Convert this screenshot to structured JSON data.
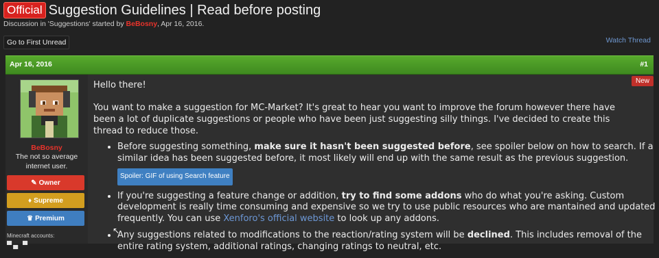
{
  "thread": {
    "prefix": "Official",
    "title": "Suggestion Guidelines | Read before posting",
    "meta_before": "Discussion in 'Suggestions' started by",
    "meta_user": "BeBosny",
    "meta_after": ", Apr 16, 2016.",
    "goto_first_unread": "Go to First Unread",
    "watch_thread": "Watch Thread"
  },
  "post": {
    "date": "Apr 16, 2016",
    "number": "#1",
    "new_label": "New",
    "author": {
      "name": "BeBosny",
      "user_title": "The not so average internet user.",
      "badges": [
        {
          "icon": "✎",
          "label": "Owner"
        },
        {
          "icon": "♦",
          "label": "Supreme"
        },
        {
          "icon": "♛",
          "label": "Premium"
        }
      ],
      "minecraft_label": "Minecraft accounts:",
      "minecraft_icons": "▀▄ ▀"
    },
    "greeting": "Hello there!",
    "intro": "You want to make a suggestion for MC-Market? It's great to hear you want to improve the forum however there have been a lot of duplicate suggestions or people who have been just suggesting silly things. I've decided to create this thread to reduce those.",
    "rules": {
      "r1_a": "Before suggesting something, ",
      "r1_b": "make sure it hasn't been suggested before",
      "r1_c": ", see spoiler below on how to search. If a similar idea has been suggested before, it most likely will end up with the same result as the previous suggestion.",
      "spoiler": "Spoiler: GIF of using Search feature",
      "r2_a": "If you're suggesting a feature change or addition, ",
      "r2_b": "try to find some addons",
      "r2_c": " who do what you're asking. Custom development is really time consuming and expensive so we try to use public resources who are mantained and updated frequently. You can use ",
      "r2_link": "Xenforo's official website",
      "r2_d": " to look up any addons.",
      "r3_a": "Any suggestions related to modifications to the reaction/rating system will be ",
      "r3_b": "declined",
      "r3_c": ". This includes removal of the entire rating system, additional ratings, changing ratings to neutral, etc."
    }
  },
  "colors": {
    "background": "#222222",
    "post_header_green": "#4f9d2a",
    "prefix_red": "#d8221f",
    "username_red": "#e8332b",
    "link_blue": "#6d98d6"
  }
}
